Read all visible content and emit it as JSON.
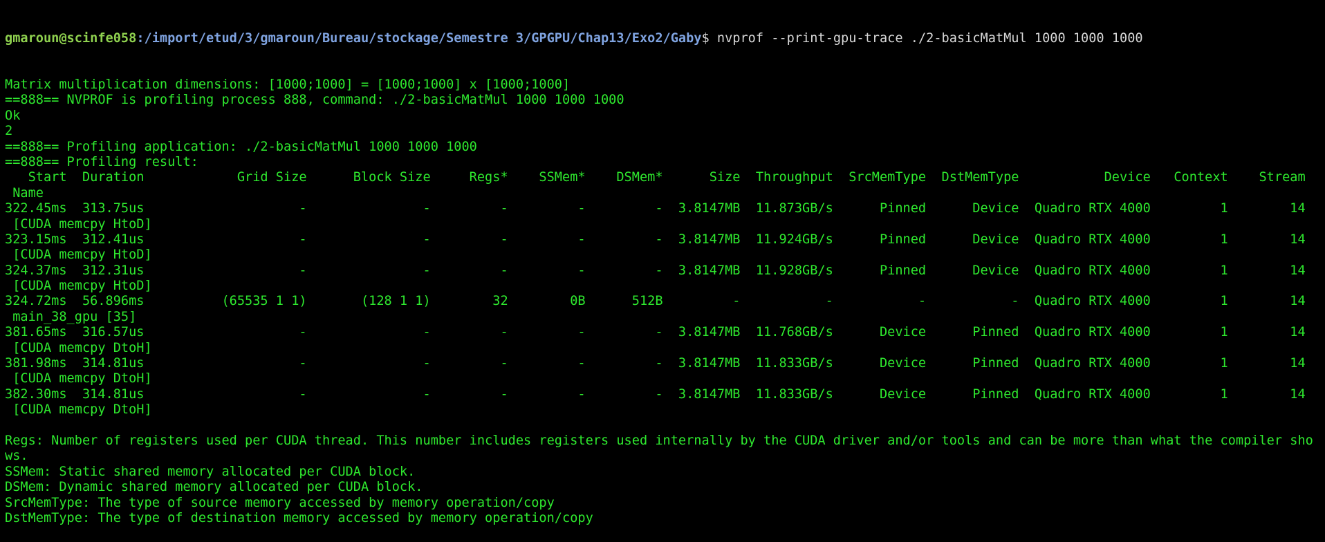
{
  "terminal": {
    "prompt_user": "gmaroun@scinfe058",
    "prompt_path": ":/import/etud/3/gmaroun/Bureau/stockage/Semestre 3/GPGPU/Chap13/Exo2/Gaby",
    "prompt_symbol": "$ ",
    "command": "nvprof --print-gpu-trace ./2-basicMatMul 1000 1000 1000",
    "lines": [
      "Matrix multiplication dimensions: [1000;1000] = [1000;1000] x [1000;1000]",
      "==888== NVPROF is profiling process 888, command: ./2-basicMatMul 1000 1000 1000",
      "Ok",
      "2",
      "==888== Profiling application: ./2-basicMatMul 1000 1000 1000",
      "==888== Profiling result:",
      "   Start  Duration            Grid Size      Block Size     Regs*    SSMem*    DSMem*      Size  Throughput  SrcMemType  DstMemType           Device   Context    Stream",
      " Name",
      "322.45ms  313.75us                    -               -         -         -         -  3.8147MB  11.873GB/s      Pinned      Device  Quadro RTX 4000         1        14",
      " [CUDA memcpy HtoD]",
      "323.15ms  312.41us                    -               -         -         -         -  3.8147MB  11.924GB/s      Pinned      Device  Quadro RTX 4000         1        14",
      " [CUDA memcpy HtoD]",
      "324.37ms  312.31us                    -               -         -         -         -  3.8147MB  11.928GB/s      Pinned      Device  Quadro RTX 4000         1        14",
      " [CUDA memcpy HtoD]",
      "324.72ms  56.896ms          (65535 1 1)       (128 1 1)        32        0B      512B         -           -           -           -  Quadro RTX 4000         1        14",
      " main_38_gpu [35]",
      "381.65ms  316.57us                    -               -         -         -         -  3.8147MB  11.768GB/s      Device      Pinned  Quadro RTX 4000         1        14",
      " [CUDA memcpy DtoH]",
      "381.98ms  314.81us                    -               -         -         -         -  3.8147MB  11.833GB/s      Device      Pinned  Quadro RTX 4000         1        14",
      " [CUDA memcpy DtoH]",
      "382.30ms  314.81us                    -               -         -         -         -  3.8147MB  11.833GB/s      Device      Pinned  Quadro RTX 4000         1        14",
      " [CUDA memcpy DtoH]",
      "",
      "Regs: Number of registers used per CUDA thread. This number includes registers used internally by the CUDA driver and/or tools and can be more than what the compiler sho",
      "ws.",
      "SSMem: Static shared memory allocated per CUDA block.",
      "DSMem: Dynamic shared memory allocated per CUDA block.",
      "SrcMemType: The type of source memory accessed by memory operation/copy",
      "DstMemType: The type of destination memory accessed by memory operation/copy"
    ]
  }
}
